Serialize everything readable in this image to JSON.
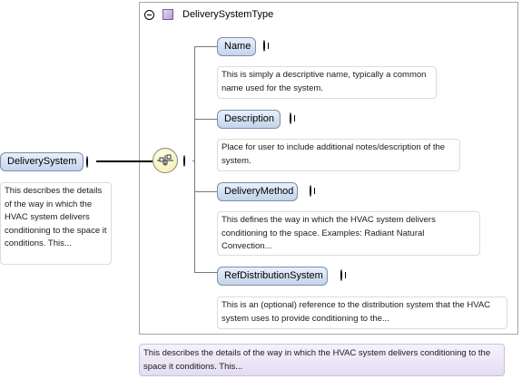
{
  "root": {
    "name": "DeliverySystem",
    "documentation": "This describes the details of the way in which the HVAC system delivers conditioning to the space it conditions. This..."
  },
  "type": {
    "name": "DeliverySystemType"
  },
  "compositor": {
    "icon": "sequence-icon"
  },
  "children": [
    {
      "name": "Name",
      "documentation": "This is simply a descriptive name, typically a common name used for the system."
    },
    {
      "name": "Description",
      "documentation": "Place for user to include additional notes/description of the system."
    },
    {
      "name": "DeliveryMethod",
      "documentation": "This defines the way in which the HVAC system delivers conditioning to the space. Examples: Radiant Natural Convection..."
    },
    {
      "name": "RefDistributionSystem",
      "documentation": "This is an (optional) reference to the distribution system that the HVAC system uses to provide conditioning to the..."
    }
  ],
  "type_annotation": "This describes the details of the way in which the HVAC system delivers conditioning to the space it conditions. This...",
  "colors": {
    "element_fill": "#c4d4ec",
    "element_border": "#7e8ea6",
    "compositor_fill": "#f0eab0",
    "annotation_fill": "#e4ddf2"
  }
}
